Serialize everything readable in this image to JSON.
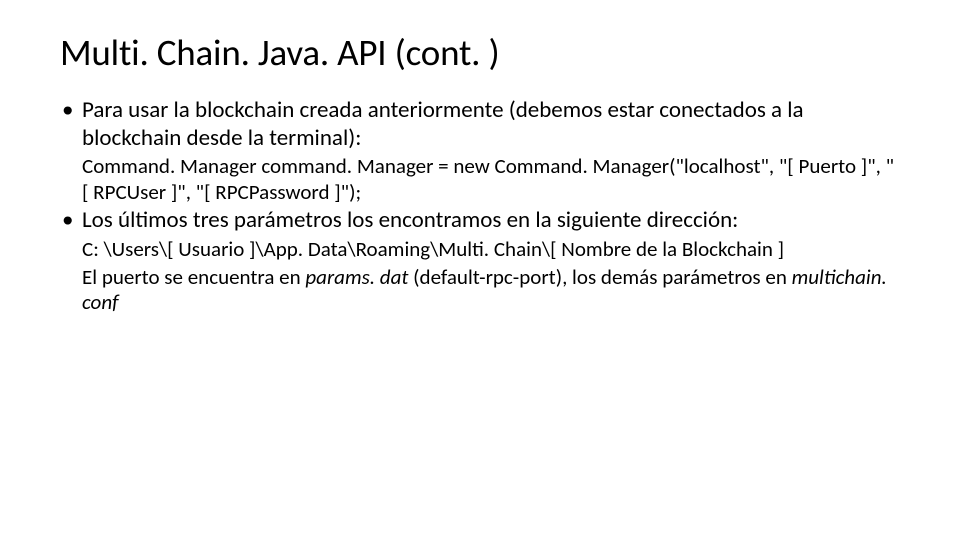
{
  "slide": {
    "title": "Multi. Chain. Java. API (cont. )",
    "bullets": [
      {
        "text": "Para usar la blockchain creada anteriormente (debemos estar conectados a la blockchain desde la terminal):",
        "sub_plain": "Command. Manager command. Manager = new Command. Manager(\"localhost\", \"[ Puerto ]\", \"[ RPCUser ]\", \"[ RPCPassword ]\");"
      },
      {
        "text": "Los últimos tres parámetros los encontramos en la siguiente dirección:",
        "sub_plain": "C: \\Users\\[ Usuario ]\\App. Data\\Roaming\\Multi. Chain\\[ Nombre de la Blockchain ]",
        "extra_parts": {
          "p1": "El puerto se encuentra en ",
          "i1": "params. dat",
          "p2": " (default-rpc-port), los demás parámetros en ",
          "i2": "multichain. conf"
        }
      }
    ]
  }
}
